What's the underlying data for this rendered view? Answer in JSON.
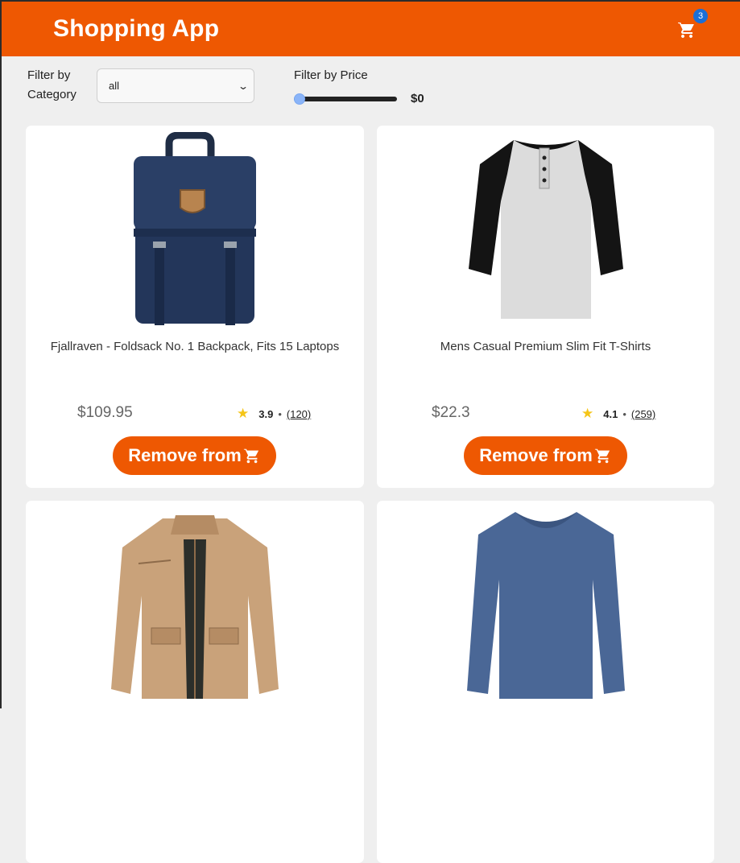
{
  "header": {
    "title": "Shopping App",
    "cart_count": "3"
  },
  "filters": {
    "category_label": "Filter by Category",
    "category_value": "all",
    "price_label": "Filter by Price",
    "price_value": "$0",
    "price_slider_fraction": 0
  },
  "products": [
    {
      "title": "Fjallraven - Foldsack No. 1 Backpack, Fits 15 Laptops",
      "price": "$109.95",
      "rate": "3.9",
      "count": "(120)",
      "button": "Remove from",
      "image": "backpack"
    },
    {
      "title": "Mens Casual Premium Slim Fit T-Shirts",
      "price": "$22.3",
      "rate": "4.1",
      "count": "(259)",
      "button": "Remove from",
      "image": "raglan-tshirt"
    },
    {
      "title": "",
      "price": "",
      "rate": "",
      "count": "",
      "button": "",
      "image": "jacket"
    },
    {
      "title": "",
      "price": "",
      "rate": "",
      "count": "",
      "button": "",
      "image": "long-sleeve-shirt"
    }
  ],
  "icons": {
    "cart": "cart-icon",
    "star": "star-icon",
    "select": "chevron-down-icon"
  },
  "colors": {
    "accent": "#ee5802",
    "badge": "#1b6fd6",
    "star": "#f5c518"
  }
}
